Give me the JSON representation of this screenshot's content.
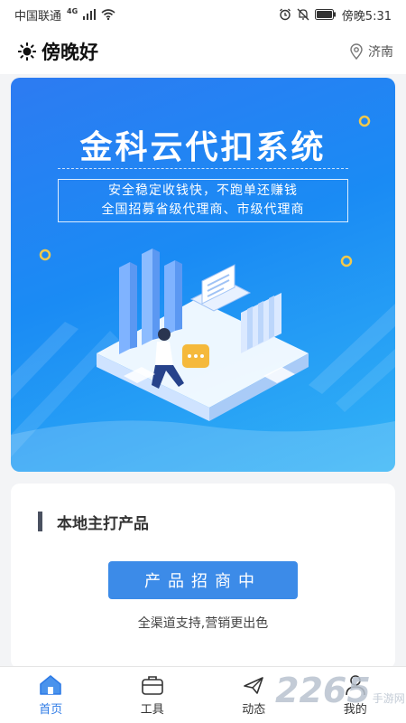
{
  "status_bar": {
    "carrier": "中国联通",
    "network": "4G",
    "time": "傍晚5:31"
  },
  "header": {
    "greeting": "傍晚好",
    "location": "济南",
    "weather_icon": "sun-icon",
    "location_icon": "map-pin-icon"
  },
  "banner": {
    "title": "金科云代扣系统",
    "subtitle_line1": "安全稳定收钱快，不跑单还赚钱",
    "subtitle_line2": "全国招募省级代理商、市级代理商"
  },
  "product_card": {
    "heading": "本地主打产品",
    "button_label": "产品招商中",
    "tagline": "全渠道支持,营销更出色"
  },
  "tabbar": {
    "tabs": [
      {
        "label": "首页",
        "icon": "home-icon",
        "active": true
      },
      {
        "label": "工具",
        "icon": "toolbox-icon",
        "active": false
      },
      {
        "label": "动态",
        "icon": "plane-icon",
        "active": false
      },
      {
        "label": "我的",
        "icon": "user-icon",
        "active": false
      }
    ]
  },
  "watermark": {
    "number": "2265",
    "text": "手游网"
  },
  "colors": {
    "accent": "#2e7be6",
    "button": "#3c8be8",
    "banner_start": "#2d7bf2",
    "banner_end": "#32b3f6"
  }
}
